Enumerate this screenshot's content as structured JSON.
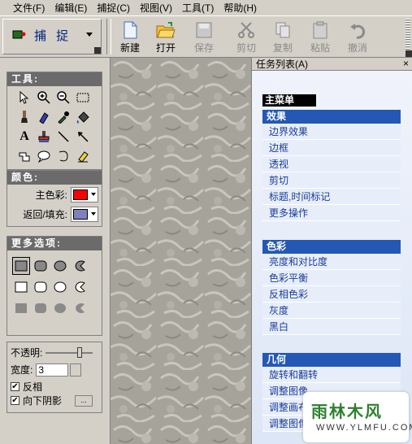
{
  "menubar": {
    "items": [
      {
        "label": "文件(F)",
        "key": "F"
      },
      {
        "label": "编辑(E)",
        "key": "E"
      },
      {
        "label": "捕捉(C)",
        "key": "C"
      },
      {
        "label": "视图(V)",
        "key": "V"
      },
      {
        "label": "工具(T)",
        "key": "T"
      },
      {
        "label": "帮助(H)",
        "key": "H"
      }
    ]
  },
  "toolbar": {
    "capture_label": "捕 捉",
    "new_label": "新建",
    "open_label": "打开",
    "save_label": "保存",
    "cut_label": "剪切",
    "copy_label": "复制",
    "paste_label": "粘贴",
    "undo_label": "撤消"
  },
  "tools_panel": {
    "title": "工具:"
  },
  "color_panel": {
    "title": "颜色:",
    "main_color_label": "主色彩:",
    "main_color": "#ff0000",
    "fill_color_label": "返回/填充:",
    "fill_color": "#8080c0"
  },
  "more_options": {
    "title": "更多选项:"
  },
  "options": {
    "opacity_label": "不透明:",
    "opacity_fraction": 0.75,
    "width_label": "宽度:",
    "width_value": "3",
    "invert_label": "反相",
    "invert_checked": true,
    "shadow_label": "向下阴影",
    "shadow_checked": true,
    "more_button": "..."
  },
  "taskpane": {
    "title": "任务列表(A)",
    "close": "×",
    "main_menu": "主菜单",
    "groups": [
      {
        "title": "效果",
        "items": [
          "边界效果",
          "边框",
          "透视",
          "剪切",
          "标题,时间标记",
          "更多操作"
        ]
      },
      {
        "title": "色彩",
        "items": [
          "亮度和对比度",
          "色彩平衡",
          "反相色彩",
          "灰度",
          "黑白"
        ]
      },
      {
        "title": "几何",
        "items": [
          "旋转和翻转",
          "调整图像",
          "调整画布",
          "调整图像"
        ]
      }
    ]
  },
  "watermark": {
    "text": "雨林木风",
    "url": "WWW.YLMFU.COM"
  },
  "colors": {
    "accent": "#2458b4",
    "link": "#1a3b9a",
    "panel_head": "#6b6b6b"
  }
}
